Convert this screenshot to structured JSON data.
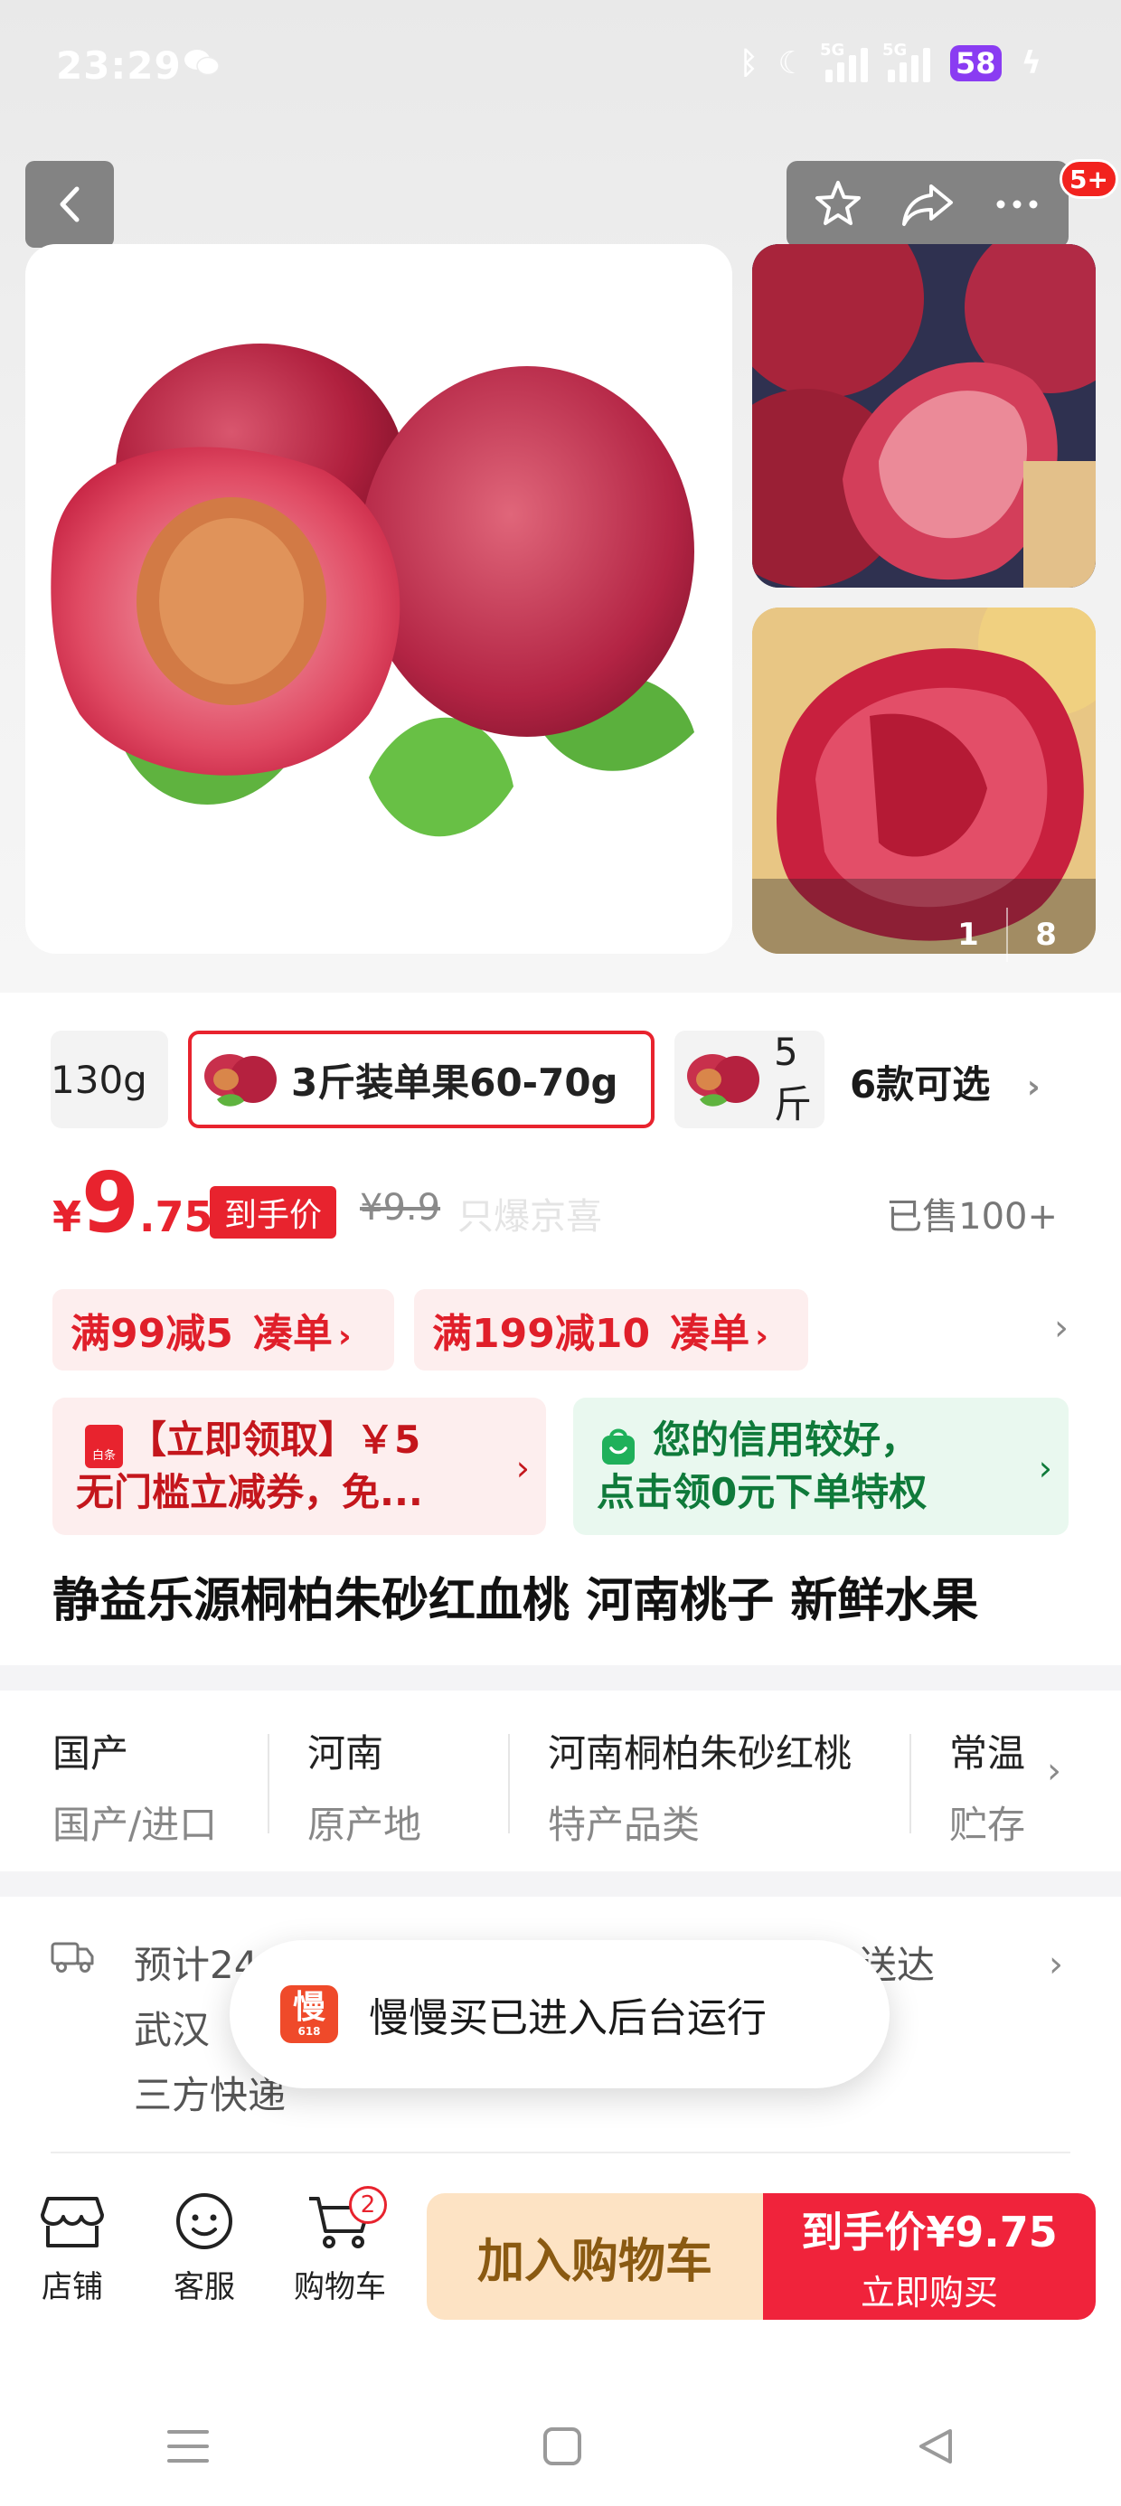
{
  "status_bar": {
    "time": "23:29",
    "signal1_label": "5G",
    "signal2_label": "5G",
    "battery": "58"
  },
  "header": {
    "badge": "5+"
  },
  "gallery": {
    "current": "1",
    "total": "8"
  },
  "variants": {
    "items": [
      {
        "label": "130g"
      },
      {
        "label": "3斤装单果60-70g",
        "selected": true
      },
      {
        "label": "5斤"
      }
    ],
    "more_label": "6款可选"
  },
  "price": {
    "symbol": "¥",
    "integer": "9",
    "decimal": ".75",
    "tag": "到手价",
    "original": "¥9.9",
    "ghost_text": "只爆京喜",
    "sold": "已售100+"
  },
  "promos": [
    {
      "text": "满99减5",
      "action": "凑单"
    },
    {
      "text": "满199减10",
      "action": "凑单"
    }
  ],
  "coupons": {
    "left": {
      "icon_text": "白条",
      "line1": "【立即领取】￥5",
      "line2": "无门槛立减券，免..."
    },
    "right": {
      "line1": "您的信用较好，",
      "line2": "点击领0元下单特权"
    }
  },
  "product_title": "静益乐源桐柏朱砂红血桃 河南桃子 新鲜水果",
  "attributes": [
    {
      "value": "国产",
      "key": "国产/进口"
    },
    {
      "value": "河南",
      "key": "原产地"
    },
    {
      "value": "河南桐柏朱砂红桃",
      "key": "特产品类"
    },
    {
      "value": "常温",
      "key": "贮存"
    }
  ],
  "delivery": {
    "line1": "预计24",
    "line1_tail": "送达",
    "line2": "武汉",
    "line3": "三方快递"
  },
  "toast": {
    "logo_text": "慢",
    "logo_sub": "618",
    "text": "慢慢买已进入后台运行"
  },
  "bottom_bar": {
    "store": "店铺",
    "service": "客服",
    "cart": "购物车",
    "cart_count": "2",
    "add_to_cart": "加入购物车",
    "buy_line1": "到手价¥9.75",
    "buy_line2": "立即购买"
  },
  "colors": {
    "accent_red": "#e8232e",
    "cart_button_bg": "#fde3c4",
    "buy_button_bg": "#f0233b",
    "battery": "#8a3cf2"
  }
}
